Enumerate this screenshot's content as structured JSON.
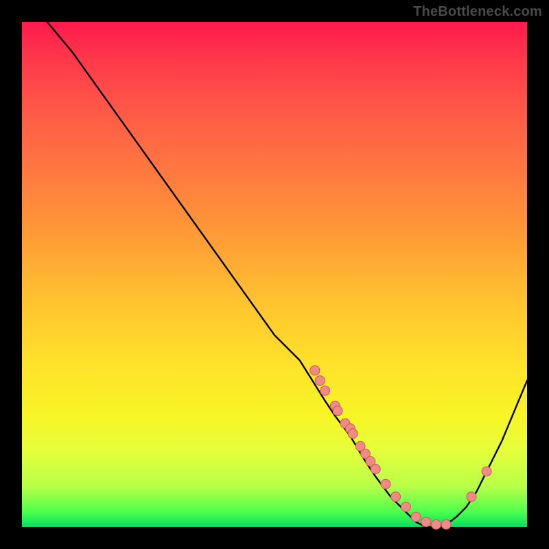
{
  "watermark": "TheBottleneck.com",
  "colors": {
    "background": "#000000",
    "curve": "#000000",
    "points_fill": "#ef8a87",
    "points_stroke": "#c85a57"
  },
  "chart_data": {
    "type": "line",
    "title": "",
    "xlabel": "",
    "ylabel": "",
    "xlim": [
      0,
      100
    ],
    "ylim": [
      0,
      100
    ],
    "curve": {
      "comment": "Bottleneck-style curve: mismatch % (y) vs some component index (x). High at left, dips to ~0 near x≈80, rises again.",
      "x": [
        5,
        10,
        15,
        20,
        25,
        30,
        35,
        40,
        45,
        50,
        55,
        60,
        62,
        65,
        68,
        70,
        73,
        76,
        78,
        80,
        82,
        84,
        86,
        88,
        90,
        92,
        95,
        100
      ],
      "y": [
        100,
        94,
        87,
        80,
        73,
        66,
        59,
        52,
        45,
        38,
        33,
        25,
        22,
        18,
        13,
        10,
        6,
        3,
        1,
        0,
        0,
        0.5,
        2,
        4,
        7,
        11,
        17,
        29
      ]
    },
    "points": {
      "comment": "Salmon sample markers along the curve, clustered mid-right and near the trough.",
      "x": [
        58,
        59,
        60,
        62,
        62.5,
        64,
        65,
        65.5,
        67,
        68,
        69,
        70,
        72,
        74,
        76,
        78,
        80,
        82,
        84,
        89,
        92
      ],
      "y": [
        31,
        29,
        27,
        24,
        23,
        20.5,
        19.5,
        18.5,
        16,
        14.5,
        13,
        11.5,
        8.5,
        6,
        4,
        2,
        1,
        0.5,
        0.5,
        6,
        11
      ]
    }
  }
}
